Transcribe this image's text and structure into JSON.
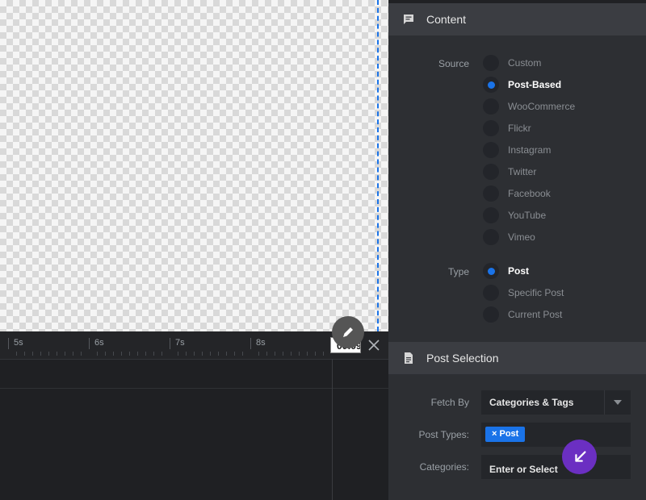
{
  "timeline": {
    "ticks": [
      {
        "label": "5s"
      },
      {
        "label": "6s"
      },
      {
        "label": "7s"
      },
      {
        "label": "8s"
      }
    ],
    "current_time": "00:09",
    "close_icon": "close-icon"
  },
  "panel": {
    "content_section": {
      "title": "Content",
      "icon": "comment-icon",
      "source_label": "Source",
      "source_options": [
        "Custom",
        "Post-Based",
        "WooCommerce",
        "Flickr",
        "Instagram",
        "Twitter",
        "Facebook",
        "YouTube",
        "Vimeo"
      ],
      "source_selected": "Post-Based",
      "type_label": "Type",
      "type_options": [
        "Post",
        "Specific Post",
        "Current Post"
      ],
      "type_selected": "Post"
    },
    "post_selection_section": {
      "title": "Post Selection",
      "icon": "document-icon",
      "fetch_by_label": "Fetch By",
      "fetch_by_value": "Categories & Tags",
      "post_types_label": "Post Types:",
      "post_types_tags": [
        "× Post"
      ],
      "categories_label": "Categories:",
      "categories_value": "Enter or Select"
    }
  },
  "colors": {
    "accent": "#1a73e8",
    "cursor_badge": "#6b2fc2",
    "panel_bg": "#2d2f33",
    "header_bg": "#3b3d42"
  }
}
